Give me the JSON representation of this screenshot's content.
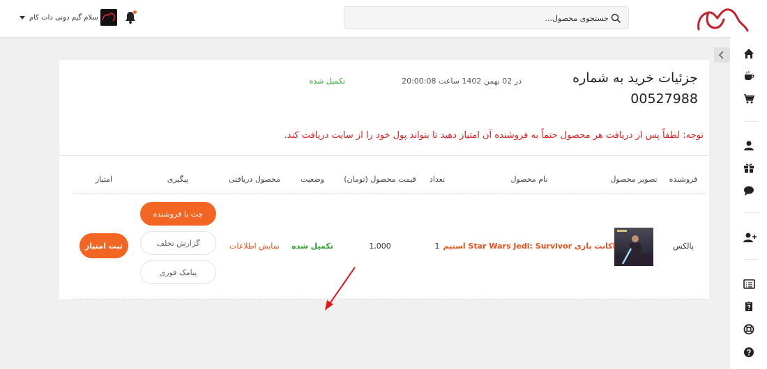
{
  "header": {
    "search_placeholder": "جستجوی محصول...",
    "user_name": "سلام گیم دونی دات کام"
  },
  "order": {
    "title_line1": "جزئیات خرید به شماره",
    "order_number": "00527988",
    "datetime": "در 02 بهمن 1402 ساعت 20:00:08",
    "status": "تکمیل شده",
    "notice": "توجه: لطفاً پس از دریافت هر محصول حتماً به فروشنده آن امتیاز دهید تا بتواند پول خود را از سایت دریافت کند."
  },
  "table": {
    "headers": {
      "seller": "فروشنده",
      "image": "تصویر محصول",
      "name": "نام محصول",
      "qty": "تعداد",
      "price": "قیمت محصول (تومان)",
      "status": "وضعیت",
      "received": "محصول دریافتی",
      "followup": "پیگیری",
      "rating": "امتیاز"
    },
    "rows": [
      {
        "seller": "پالکس",
        "name": "اکانت بازی Star Wars Jedi: Survivor استیم",
        "qty": "1",
        "price": "1,000",
        "status": "تکمیل شده",
        "received_link": "نمایش اطلاعات",
        "chat_button": "چت با فروشنده",
        "report_button": "گزارش تخلف",
        "sms_button": "پیامک فوری",
        "rate_button": "ثبت امتیاز"
      }
    ]
  },
  "colors": {
    "accent": "#f26522",
    "success": "#2ca02c",
    "alert": "#e02020",
    "link": "#e8501c",
    "logo": "#c8202a"
  },
  "icons": {
    "sidebar": [
      "home-icon",
      "coffee-icon",
      "cart-icon",
      "user-icon",
      "gift-icon",
      "chat-icon",
      "add-user-icon",
      "list-icon",
      "clipboard-question-icon",
      "support-icon",
      "help-icon"
    ]
  }
}
